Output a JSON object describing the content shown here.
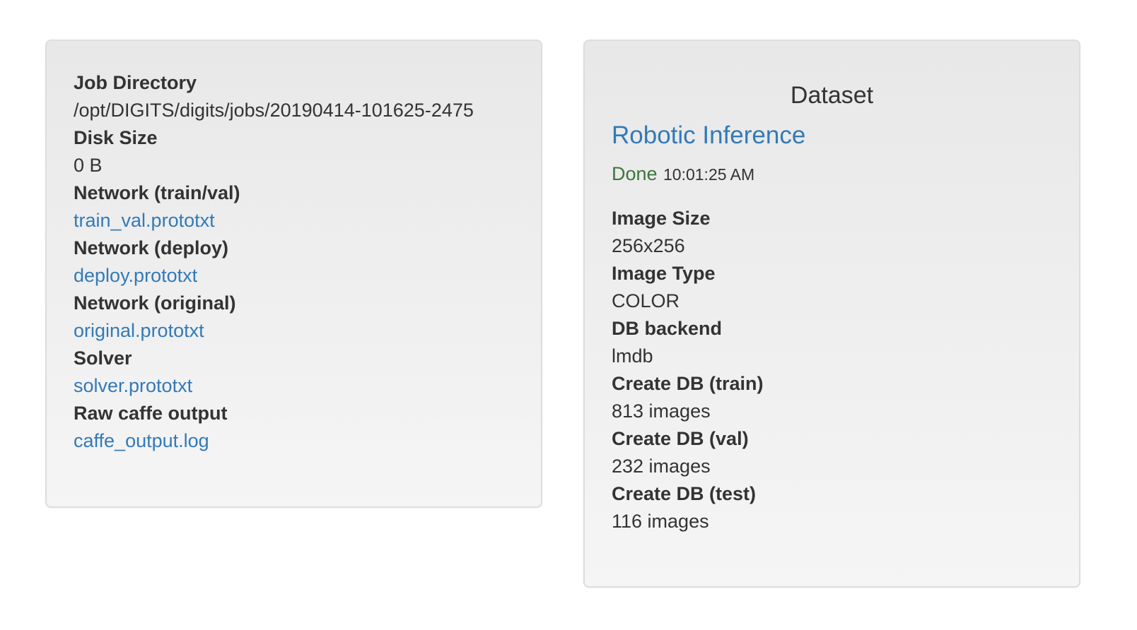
{
  "job_panel": {
    "items": [
      {
        "label": "Job Directory",
        "value": "/opt/DIGITS/digits/jobs/20190414-101625-2475",
        "is_link": false
      },
      {
        "label": "Disk Size",
        "value": "0 B",
        "is_link": false
      },
      {
        "label": "Network (train/val)",
        "value": "train_val.prototxt",
        "is_link": true
      },
      {
        "label": "Network (deploy)",
        "value": "deploy.prototxt",
        "is_link": true
      },
      {
        "label": "Network (original)",
        "value": "original.prototxt",
        "is_link": true
      },
      {
        "label": "Solver",
        "value": "solver.prototxt",
        "is_link": true
      },
      {
        "label": "Raw caffe output",
        "value": "caffe_output.log",
        "is_link": true
      }
    ]
  },
  "dataset_panel": {
    "title": "Dataset",
    "dataset_name": "Robotic Inference",
    "status": "Done",
    "status_time": "10:01:25 AM",
    "items": [
      {
        "label": "Image Size",
        "value": "256x256"
      },
      {
        "label": "Image Type",
        "value": "COLOR"
      },
      {
        "label": "DB backend",
        "value": "lmdb"
      },
      {
        "label": "Create DB (train)",
        "value": "813 images"
      },
      {
        "label": "Create DB (val)",
        "value": "232 images"
      },
      {
        "label": "Create DB (test)",
        "value": "116 images"
      }
    ]
  },
  "colors": {
    "link": "#337ab7",
    "status_done": "#3c763d",
    "text": "#333333",
    "panel_border": "#dddddd"
  }
}
